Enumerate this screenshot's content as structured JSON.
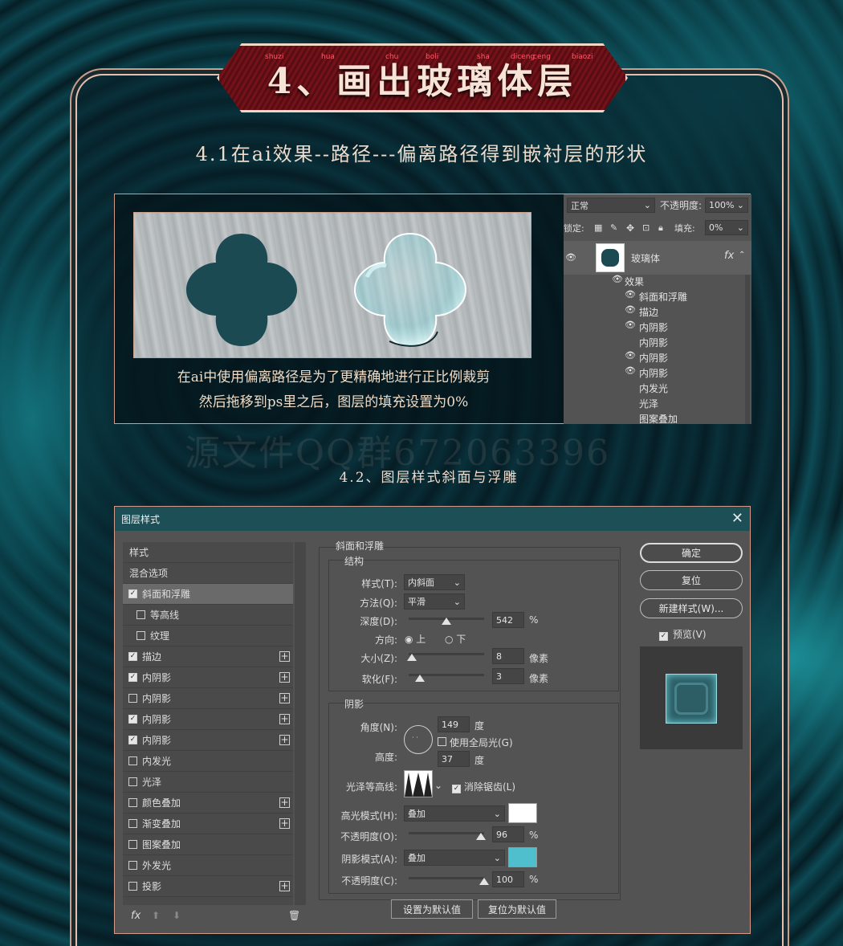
{
  "header": {
    "title": "4、画出玻璃体层",
    "pinyin": [
      "shuzi",
      "hua",
      "chu",
      "boli",
      "sha",
      "diceng",
      "ceng",
      "biaozi"
    ],
    "subtitle1": "4.1在ai效果--路径---偏离路径得到嵌衬层的形状",
    "subtitle2": "4.2、图层样式斜面与浮雕",
    "watermark": "源文件QQ群672063396"
  },
  "section1": {
    "desc_line1": "在ai中使用偏离路径是为了更精确地进行正比例裁剪",
    "desc_line2": "然后拖移到ps里之后，图层的填充设置为0%"
  },
  "layers_panel": {
    "blend_mode": "正常",
    "opacity_label": "不透明度:",
    "opacity_value": "100%",
    "lock_label": "锁定:",
    "fill_label": "填充:",
    "fill_value": "0%",
    "layer_name": "玻璃体",
    "fx_label": "fx",
    "effects_label": "效果",
    "effects": [
      {
        "label": "斜面和浮雕",
        "visible": true
      },
      {
        "label": "描边",
        "visible": true
      },
      {
        "label": "内阴影",
        "visible": true
      },
      {
        "label": "内阴影",
        "visible": false
      },
      {
        "label": "内阴影",
        "visible": true
      },
      {
        "label": "内阴影",
        "visible": true
      },
      {
        "label": "内发光",
        "visible": false
      },
      {
        "label": "光泽",
        "visible": false
      },
      {
        "label": "图案叠加",
        "visible": false
      }
    ],
    "colors": {
      "shape_fill": "#1b4a53",
      "glass_tint": "#7fe3ea"
    }
  },
  "dialog": {
    "title": "图层样式",
    "left_list": [
      {
        "label": "样式",
        "checkbox": null,
        "plus": false,
        "indent": false
      },
      {
        "label": "混合选项",
        "checkbox": null,
        "plus": false,
        "indent": false
      },
      {
        "label": "斜面和浮雕",
        "checkbox": true,
        "plus": false,
        "indent": false,
        "selected": true
      },
      {
        "label": "等高线",
        "checkbox": false,
        "plus": false,
        "indent": true
      },
      {
        "label": "纹理",
        "checkbox": false,
        "plus": false,
        "indent": true
      },
      {
        "label": "描边",
        "checkbox": true,
        "plus": true,
        "indent": false
      },
      {
        "label": "内阴影",
        "checkbox": true,
        "plus": true,
        "indent": false
      },
      {
        "label": "内阴影",
        "checkbox": false,
        "plus": true,
        "indent": false
      },
      {
        "label": "内阴影",
        "checkbox": true,
        "plus": true,
        "indent": false
      },
      {
        "label": "内阴影",
        "checkbox": true,
        "plus": true,
        "indent": false
      },
      {
        "label": "内发光",
        "checkbox": false,
        "plus": false,
        "indent": false
      },
      {
        "label": "光泽",
        "checkbox": false,
        "plus": false,
        "indent": false
      },
      {
        "label": "颜色叠加",
        "checkbox": false,
        "plus": true,
        "indent": false
      },
      {
        "label": "渐变叠加",
        "checkbox": false,
        "plus": true,
        "indent": false
      },
      {
        "label": "图案叠加",
        "checkbox": false,
        "plus": false,
        "indent": false
      },
      {
        "label": "外发光",
        "checkbox": false,
        "plus": false,
        "indent": false
      },
      {
        "label": "投影",
        "checkbox": false,
        "plus": true,
        "indent": false
      }
    ],
    "footer_fx": "fx",
    "bevel": {
      "section_title": "斜面和浮雕",
      "structure_title": "结构",
      "style_label": "样式(T):",
      "style_value": "内斜面",
      "technique_label": "方法(Q):",
      "technique_value": "平滑",
      "depth_label": "深度(D):",
      "depth_value": "542",
      "depth_pct": 0.5,
      "depth_unit": "%",
      "direction_label": "方向:",
      "direction_up": "上",
      "direction_down": "下",
      "size_label": "大小(Z):",
      "size_value": "8",
      "size_pct": 0.04,
      "size_unit": "像素",
      "soften_label": "软化(F):",
      "soften_value": "3",
      "soften_pct": 0.15,
      "soften_unit": "像素"
    },
    "shading": {
      "section_title": "阴影",
      "angle_label": "角度(N):",
      "angle_value": "149",
      "angle_unit": "度",
      "global_light_label": "使用全局光(G)",
      "altitude_label": "高度:",
      "altitude_value": "37",
      "altitude_unit": "度",
      "gloss_label": "光泽等高线:",
      "antialias_label": "消除锯齿(L)",
      "highlight_mode_label": "高光模式(H):",
      "highlight_mode_value": "叠加",
      "highlight_color": "#ffffff",
      "highlight_opacity_label": "不透明度(O):",
      "highlight_opacity_value": "96",
      "highlight_opacity_pct": 0.96,
      "shadow_mode_label": "阴影模式(A):",
      "shadow_mode_value": "叠加",
      "shadow_color": "#4fbfce",
      "shadow_opacity_label": "不透明度(C):",
      "shadow_opacity_value": "100",
      "shadow_opacity_pct": 1.0,
      "pct_unit": "%"
    },
    "make_default": "设置为默认值",
    "reset_default": "复位为默认值",
    "ok": "确定",
    "reset": "复位",
    "new_style": "新建样式(W)...",
    "preview_label": "预览(V)"
  }
}
